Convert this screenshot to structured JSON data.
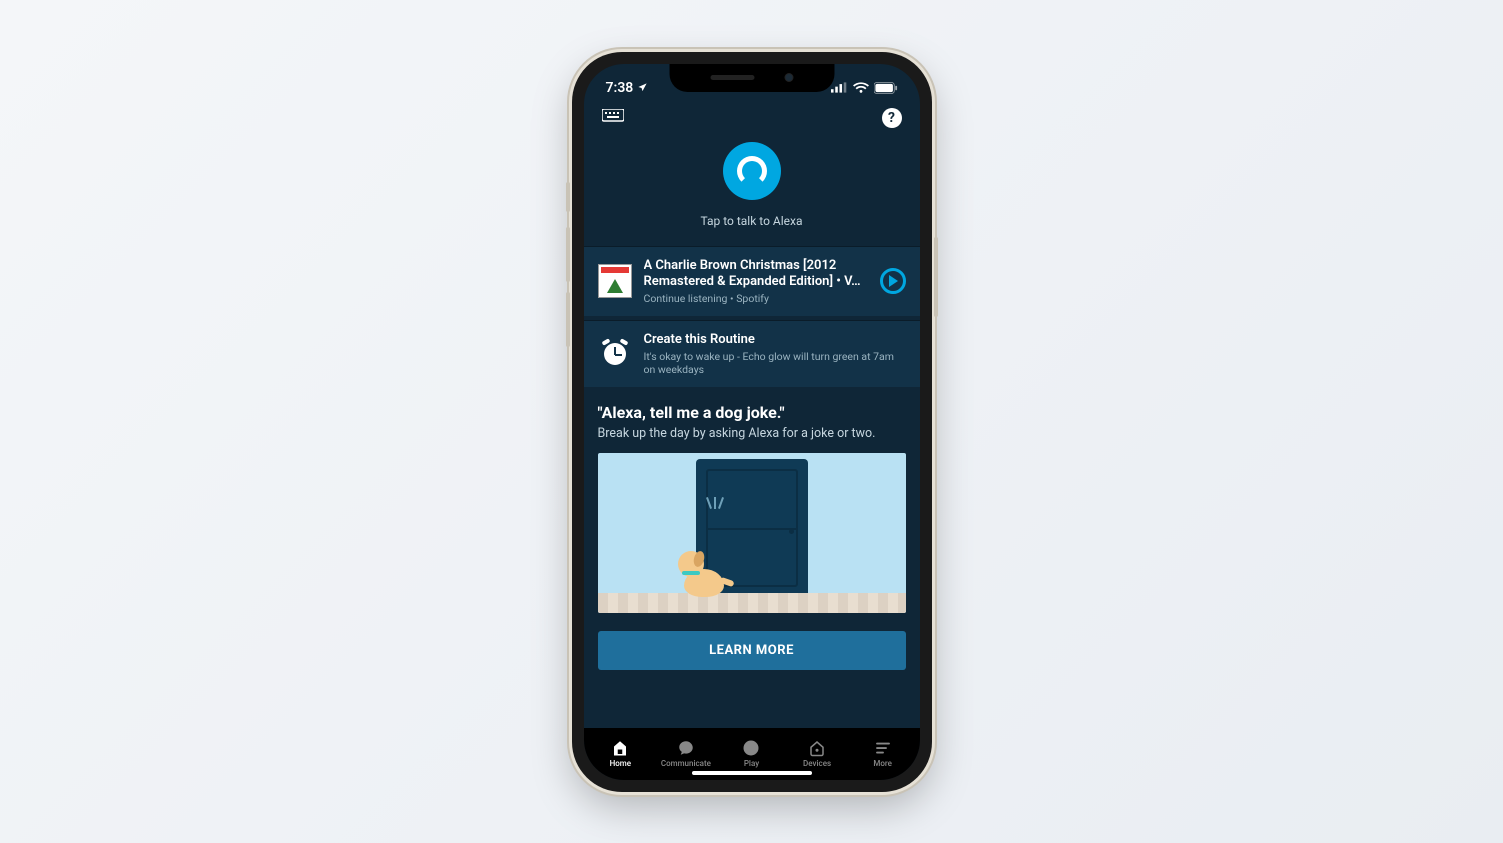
{
  "status": {
    "time": "7:38"
  },
  "header": {
    "tap_prompt": "Tap to talk to Alexa"
  },
  "card_music": {
    "title": "A Charlie Brown Christmas [2012 Remastered & Expanded Edition] • V…",
    "subtitle": "Continue listening • Spotify"
  },
  "card_routine": {
    "title": "Create this Routine",
    "subtitle": "It's okay to wake up - Echo glow will turn green at 7am on weekdays"
  },
  "feature": {
    "title": "\"Alexa, tell me a dog joke.\"",
    "subtitle": "Break up the day by asking Alexa for a joke or two.",
    "button": "LEARN MORE"
  },
  "tabs": {
    "home": "Home",
    "communicate": "Communicate",
    "play": "Play",
    "devices": "Devices",
    "more": "More"
  }
}
